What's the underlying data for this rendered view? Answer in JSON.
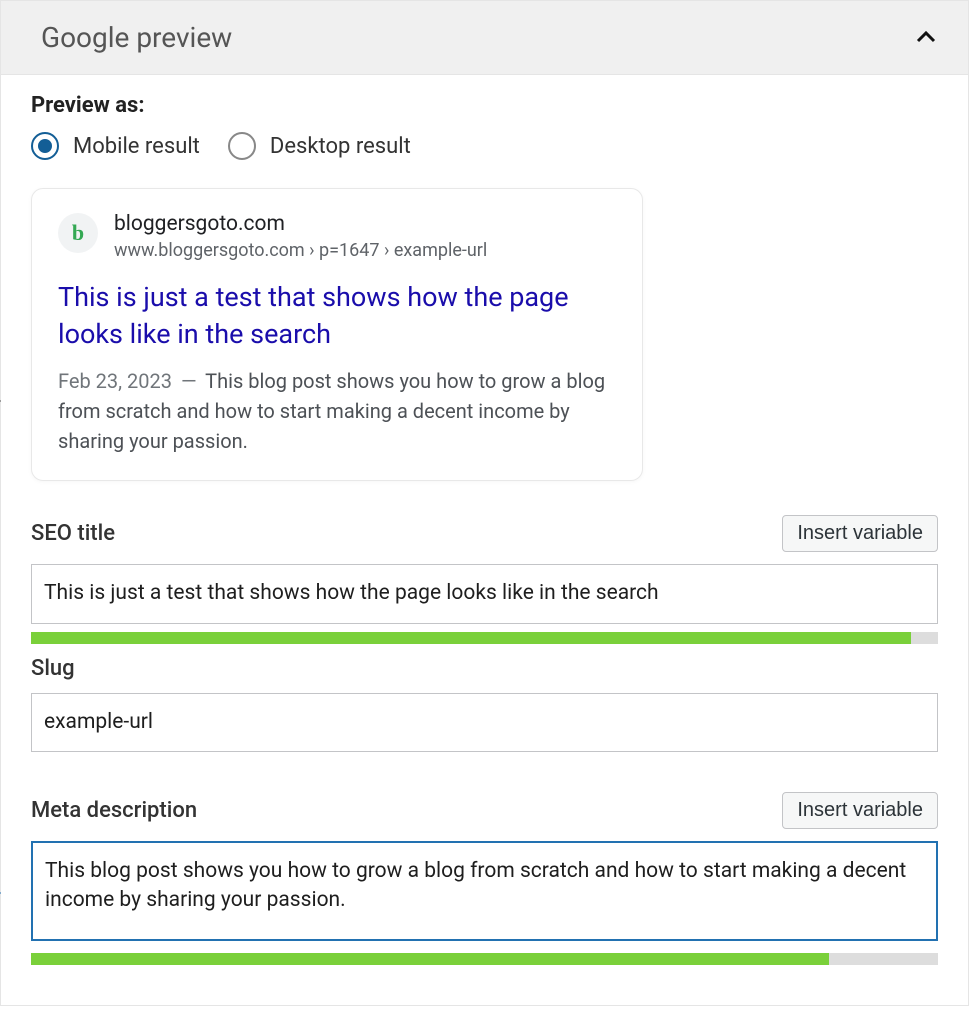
{
  "header": {
    "title": "Google preview"
  },
  "preview_as": {
    "label": "Preview as:",
    "options": {
      "mobile": "Mobile result",
      "desktop": "Desktop result"
    },
    "selected": "mobile"
  },
  "serp": {
    "favicon_letter": "b",
    "site_name": "bloggersgoto.com",
    "breadcrumb": "www.bloggersgoto.com › p=1647 › example-url",
    "title": "This is just a test that shows how the page looks like in the search",
    "date": "Feb 23, 2023",
    "dash": "—",
    "description": "This blog post shows you how to grow a blog from scratch and how to start making a decent income by sharing your passion."
  },
  "fields": {
    "insert_variable": "Insert variable",
    "seo_title": {
      "label": "SEO title",
      "value": "This is just a test that shows how the page looks like in the search",
      "progress_pct": 97
    },
    "slug": {
      "label": "Slug",
      "value": "example-url"
    },
    "meta_description": {
      "label": "Meta description",
      "value": "This blog post shows you how to grow a blog from scratch and how to start making a decent income by sharing your passion.",
      "progress_pct": 88
    }
  }
}
